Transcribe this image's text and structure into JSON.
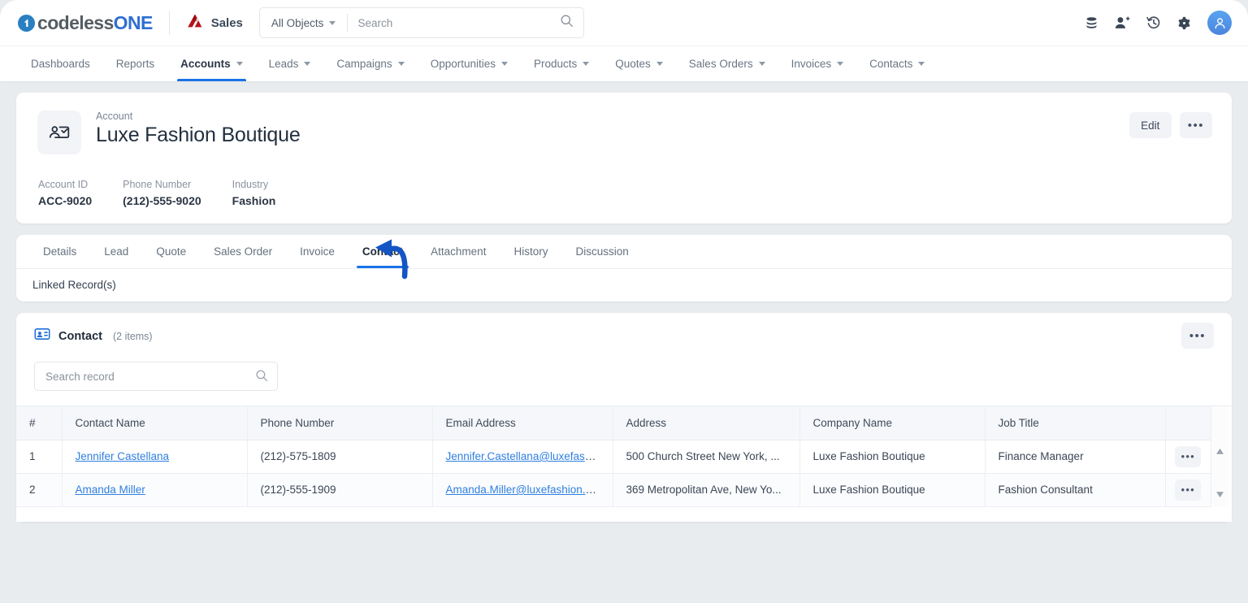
{
  "topbar": {
    "logo": {
      "mark": "one-logo-mark",
      "text_gray": "codeless",
      "text_blue": "ONE"
    },
    "app": {
      "icon": "sales-app-icon",
      "label": "Sales"
    },
    "search": {
      "object_selector": "All Objects",
      "placeholder": "Search",
      "icon": "search-icon"
    },
    "actions": [
      {
        "name": "database-icon"
      },
      {
        "name": "add-user-icon"
      },
      {
        "name": "history-icon"
      },
      {
        "name": "gear-icon"
      },
      {
        "name": "user-avatar"
      }
    ]
  },
  "nav": [
    {
      "label": "Dashboards",
      "caret": false,
      "active": false
    },
    {
      "label": "Reports",
      "caret": false,
      "active": false
    },
    {
      "label": "Accounts",
      "caret": true,
      "active": true
    },
    {
      "label": "Leads",
      "caret": true,
      "active": false
    },
    {
      "label": "Campaigns",
      "caret": true,
      "active": false
    },
    {
      "label": "Opportunities",
      "caret": true,
      "active": false
    },
    {
      "label": "Products",
      "caret": true,
      "active": false
    },
    {
      "label": "Quotes",
      "caret": true,
      "active": false
    },
    {
      "label": "Sales Orders",
      "caret": true,
      "active": false
    },
    {
      "label": "Invoices",
      "caret": true,
      "active": false
    },
    {
      "label": "Contacts",
      "caret": true,
      "active": false
    }
  ],
  "record": {
    "icon": "account-card-icon",
    "kicker": "Account",
    "title": "Luxe Fashion Boutique",
    "edit_label": "Edit",
    "more_label": "•••",
    "fields": [
      {
        "label": "Account ID",
        "value": "ACC-9020"
      },
      {
        "label": "Phone Number",
        "value": "(212)-555-9020"
      },
      {
        "label": "Industry",
        "value": "Fashion"
      }
    ]
  },
  "tabs": {
    "items": [
      {
        "label": "Details",
        "active": false
      },
      {
        "label": "Lead",
        "active": false
      },
      {
        "label": "Quote",
        "active": false
      },
      {
        "label": "Sales Order",
        "active": false
      },
      {
        "label": "Invoice",
        "active": false
      },
      {
        "label": "Contact",
        "active": true
      },
      {
        "label": "Attachment",
        "active": false
      },
      {
        "label": "History",
        "active": false
      },
      {
        "label": "Discussion",
        "active": false
      }
    ],
    "linked_label": "Linked Record(s)",
    "annotation": {
      "name": "pointer-arrow",
      "target": "Contact",
      "color": "#1355c4"
    }
  },
  "contact_panel": {
    "icon": "contact-card-icon",
    "title": "Contact",
    "count": "(2 items)",
    "more_label": "•••",
    "search": {
      "placeholder": "Search record",
      "icon": "search-icon"
    },
    "columns": [
      "#",
      "Contact Name",
      "Phone Number",
      "Email Address",
      "Address",
      "Company Name",
      "Job Title"
    ],
    "rows": [
      {
        "num": "1",
        "name": "Jennifer Castellana",
        "phone": "(212)-575-1809",
        "email": "Jennifer.Castellana@luxefash...",
        "address": "500 Church Street New York, ...",
        "company": "Luxe Fashion Boutique",
        "job": "Finance Manager",
        "action": "•••"
      },
      {
        "num": "2",
        "name": "Amanda Miller",
        "phone": "(212)-555-1909",
        "email": "Amanda.Miller@luxefashion.c...",
        "address": "369 Metropolitan Ave, New Yo...",
        "company": "Luxe Fashion Boutique",
        "job": "Fashion Consultant",
        "action": "•••"
      }
    ],
    "scroll": {
      "up": "scroll-up-arrow",
      "down": "scroll-down-arrow"
    }
  },
  "colors": {
    "accent": "#1a73e8",
    "link": "#2f7fe0",
    "page_bg": "#e9ecef",
    "annotation": "#1355c4"
  }
}
